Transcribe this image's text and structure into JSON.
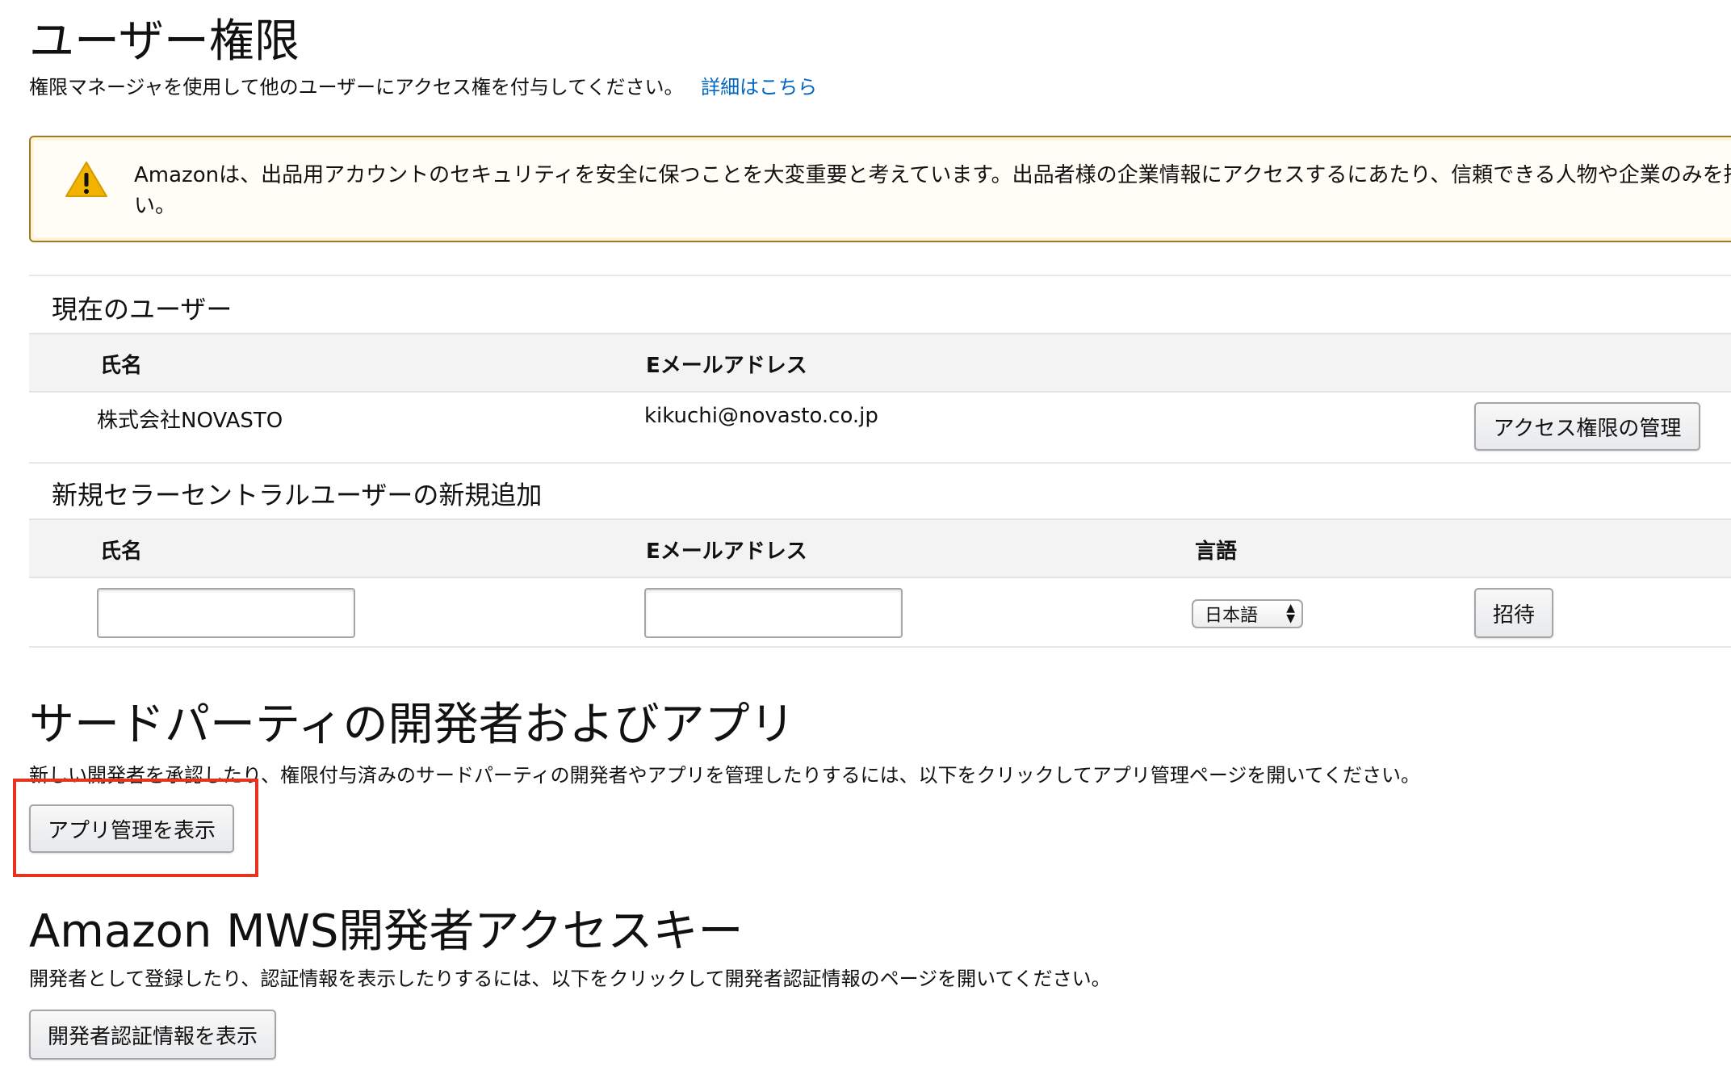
{
  "user_permissions": {
    "title": "ユーザー権限",
    "description": "権限マネージャを使用して他のユーザーにアクセス権を付与してください。",
    "details_link": "詳細はこちら"
  },
  "alert": {
    "icon": "warning-icon",
    "text": "Amazonは、出品用アカウントのセキュリティを安全に保つことを大変重要と考えています。出品者様の企業情報にアクセスするにあたり、信頼できる人物や企業のみを招",
    "text_line2": "い。"
  },
  "current_users": {
    "title": "現在のユーザー",
    "columns": [
      "氏名",
      "Eメールアドレス"
    ],
    "rows": [
      {
        "name": "株式会社NOVASTO",
        "email": "kikuchi@novasto.co.jp",
        "action_label": "アクセス権限の管理"
      }
    ]
  },
  "new_user": {
    "title": "新規セラーセントラルユーザーの新規追加",
    "columns": [
      "氏名",
      "Eメールアドレス",
      "言語"
    ],
    "name_value": "",
    "email_value": "",
    "language_selected": "日本語",
    "invite_label": "招待"
  },
  "third_party": {
    "title": "サードパーティの開発者およびアプリ",
    "description": "新しい開発者を承認したり、権限付与済みのサードパーティの開発者やアプリを管理したりするには、以下をクリックしてアプリ管理ページを開いてください。",
    "button_label": "アプリ管理を表示"
  },
  "mws": {
    "title": "Amazon MWS開発者アクセスキー",
    "description": "開発者として登録したり、認証情報を表示したりするには、以下をクリックして開発者認証情報のページを開いてください。",
    "button_label": "開発者認証情報を表示"
  },
  "colors": {
    "link": "#0066c0",
    "alert_border": "#9c7b2a",
    "highlight": "#e8321f",
    "warning_icon": "#f2b200"
  }
}
